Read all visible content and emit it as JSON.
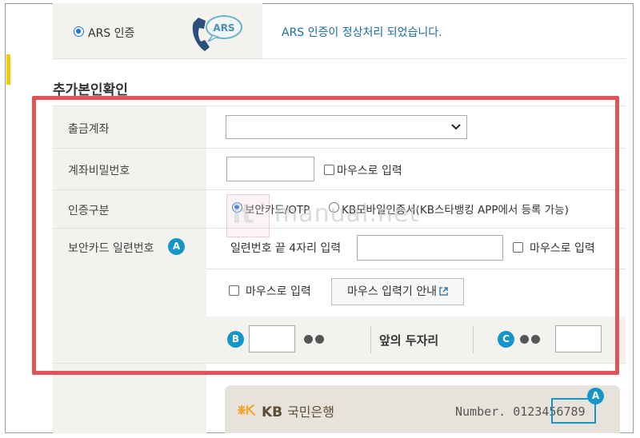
{
  "ars": {
    "label": "ARS 인증",
    "icon_text": "ARS",
    "status": "ARS 인증이 정상처리 되었습니다."
  },
  "section": {
    "title": "추가본인확인"
  },
  "form": {
    "account": {
      "label": "출금계좌",
      "selected": ""
    },
    "password": {
      "label": "계좌비밀번호",
      "mouse_label": "마우스로 입력"
    },
    "auth_type": {
      "label": "인증구분",
      "options": [
        {
          "label": "보안카드/OTP",
          "selected": true
        },
        {
          "label": "KB모바일인증서(KB스타뱅킹 APP에서 등록 가능)",
          "selected": false
        }
      ]
    },
    "security_card": {
      "label": "보안카드 일련번호",
      "badge": "A",
      "serial_label": "일련번호 끝 4자리 입력",
      "mouse_label": "마우스로 입력"
    },
    "mouse_row": {
      "mouse_label": "마우스로 입력",
      "guide_button": "마우스 입력기 안내"
    },
    "pin": {
      "badge_b": "B",
      "middle_text": "앞의 두자리",
      "badge_c": "C"
    }
  },
  "watermark": {
    "text": "manual.net",
    "it": "it"
  },
  "card": {
    "bank_short": "KB",
    "bank_name": "국민은행",
    "number_label": "Number. 0123456789",
    "badge": "A"
  },
  "colors": {
    "highlight": "#e05459",
    "badge": "#1596c9",
    "radio": "#1a73e8",
    "label_bg": "#f3f2ef",
    "status_text": "#1b6ca8"
  }
}
